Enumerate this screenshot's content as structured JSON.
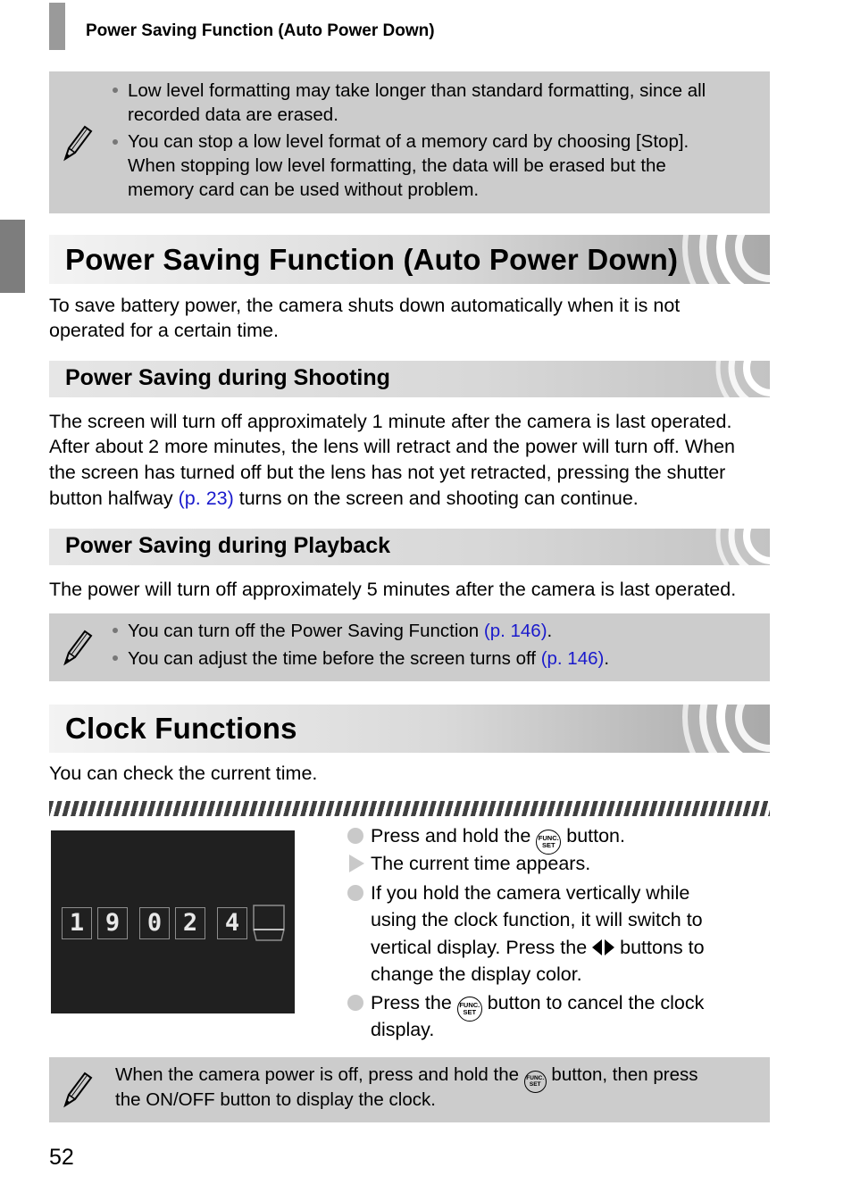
{
  "header": {
    "running_title": "Power Saving Function (Auto Power Down)"
  },
  "note1": {
    "icon": "pencil-icon",
    "items": [
      [
        "Low level formatting may take longer than standard formatting, since all",
        "recorded data are erased."
      ],
      [
        "You can stop a low level format of a memory card by choosing [Stop].",
        "When stopping low level formatting, the data will be erased but the",
        "memory card can be used without problem."
      ]
    ]
  },
  "section1": {
    "title": "Power Saving Function (Auto Power Down)",
    "intro": [
      "To save battery power, the camera shuts down automatically when it is not",
      "operated for a certain time."
    ],
    "sub1": {
      "title": "Power Saving during Shooting",
      "lines": [
        "The screen will turn off approximately 1 minute after the camera is last operated.",
        "After about 2 more minutes, the lens will retract and the power will turn off. When",
        "the screen has turned off but the lens has not yet retracted, pressing the shutter"
      ],
      "last_line_pre": "button halfway ",
      "last_line_link": "(p. 23)",
      "last_line_post": " turns on the screen and shooting can continue."
    },
    "sub2": {
      "title": "Power Saving during Playback",
      "text": "The power will turn off approximately 5 minutes after the camera is last operated."
    }
  },
  "note2": {
    "icon": "pencil-icon",
    "items": [
      {
        "text": "You can turn off the Power Saving Function ",
        "link": "(p. 146)",
        "end": "."
      },
      {
        "text": "You can adjust the time before the screen turns off ",
        "link": "(p. 146)",
        "end": "."
      }
    ]
  },
  "section2": {
    "title": "Clock Functions",
    "intro": "You can check the current time.",
    "clock_digits": [
      "1",
      "9",
      "0",
      "2",
      "4"
    ],
    "steps": {
      "s1_pre": "Press and hold the ",
      "s1_post": " button.",
      "s2": "The current time appears.",
      "s3_l1": "If you hold the camera vertically while",
      "s3_l2": "using the clock function, it will switch to",
      "s3_l3_pre": "vertical display. Press the ",
      "s3_l3_post": " buttons to",
      "s3_l4": "change the display color.",
      "s4_pre": "Press the ",
      "s4_post": " button to cancel the clock",
      "s4_l2": "display."
    },
    "func_button": {
      "top": "FUNC.",
      "bottom": "SET"
    }
  },
  "note3": {
    "icon": "pencil-icon",
    "line1_pre": "When the camera power is off, press and hold the ",
    "line1_post": " button, then press",
    "line2": "the ON/OFF button to display the clock."
  },
  "footer": {
    "page_number": "52"
  },
  "colors": {
    "link": "#1a1acc",
    "note_bg": "#cccccc"
  }
}
